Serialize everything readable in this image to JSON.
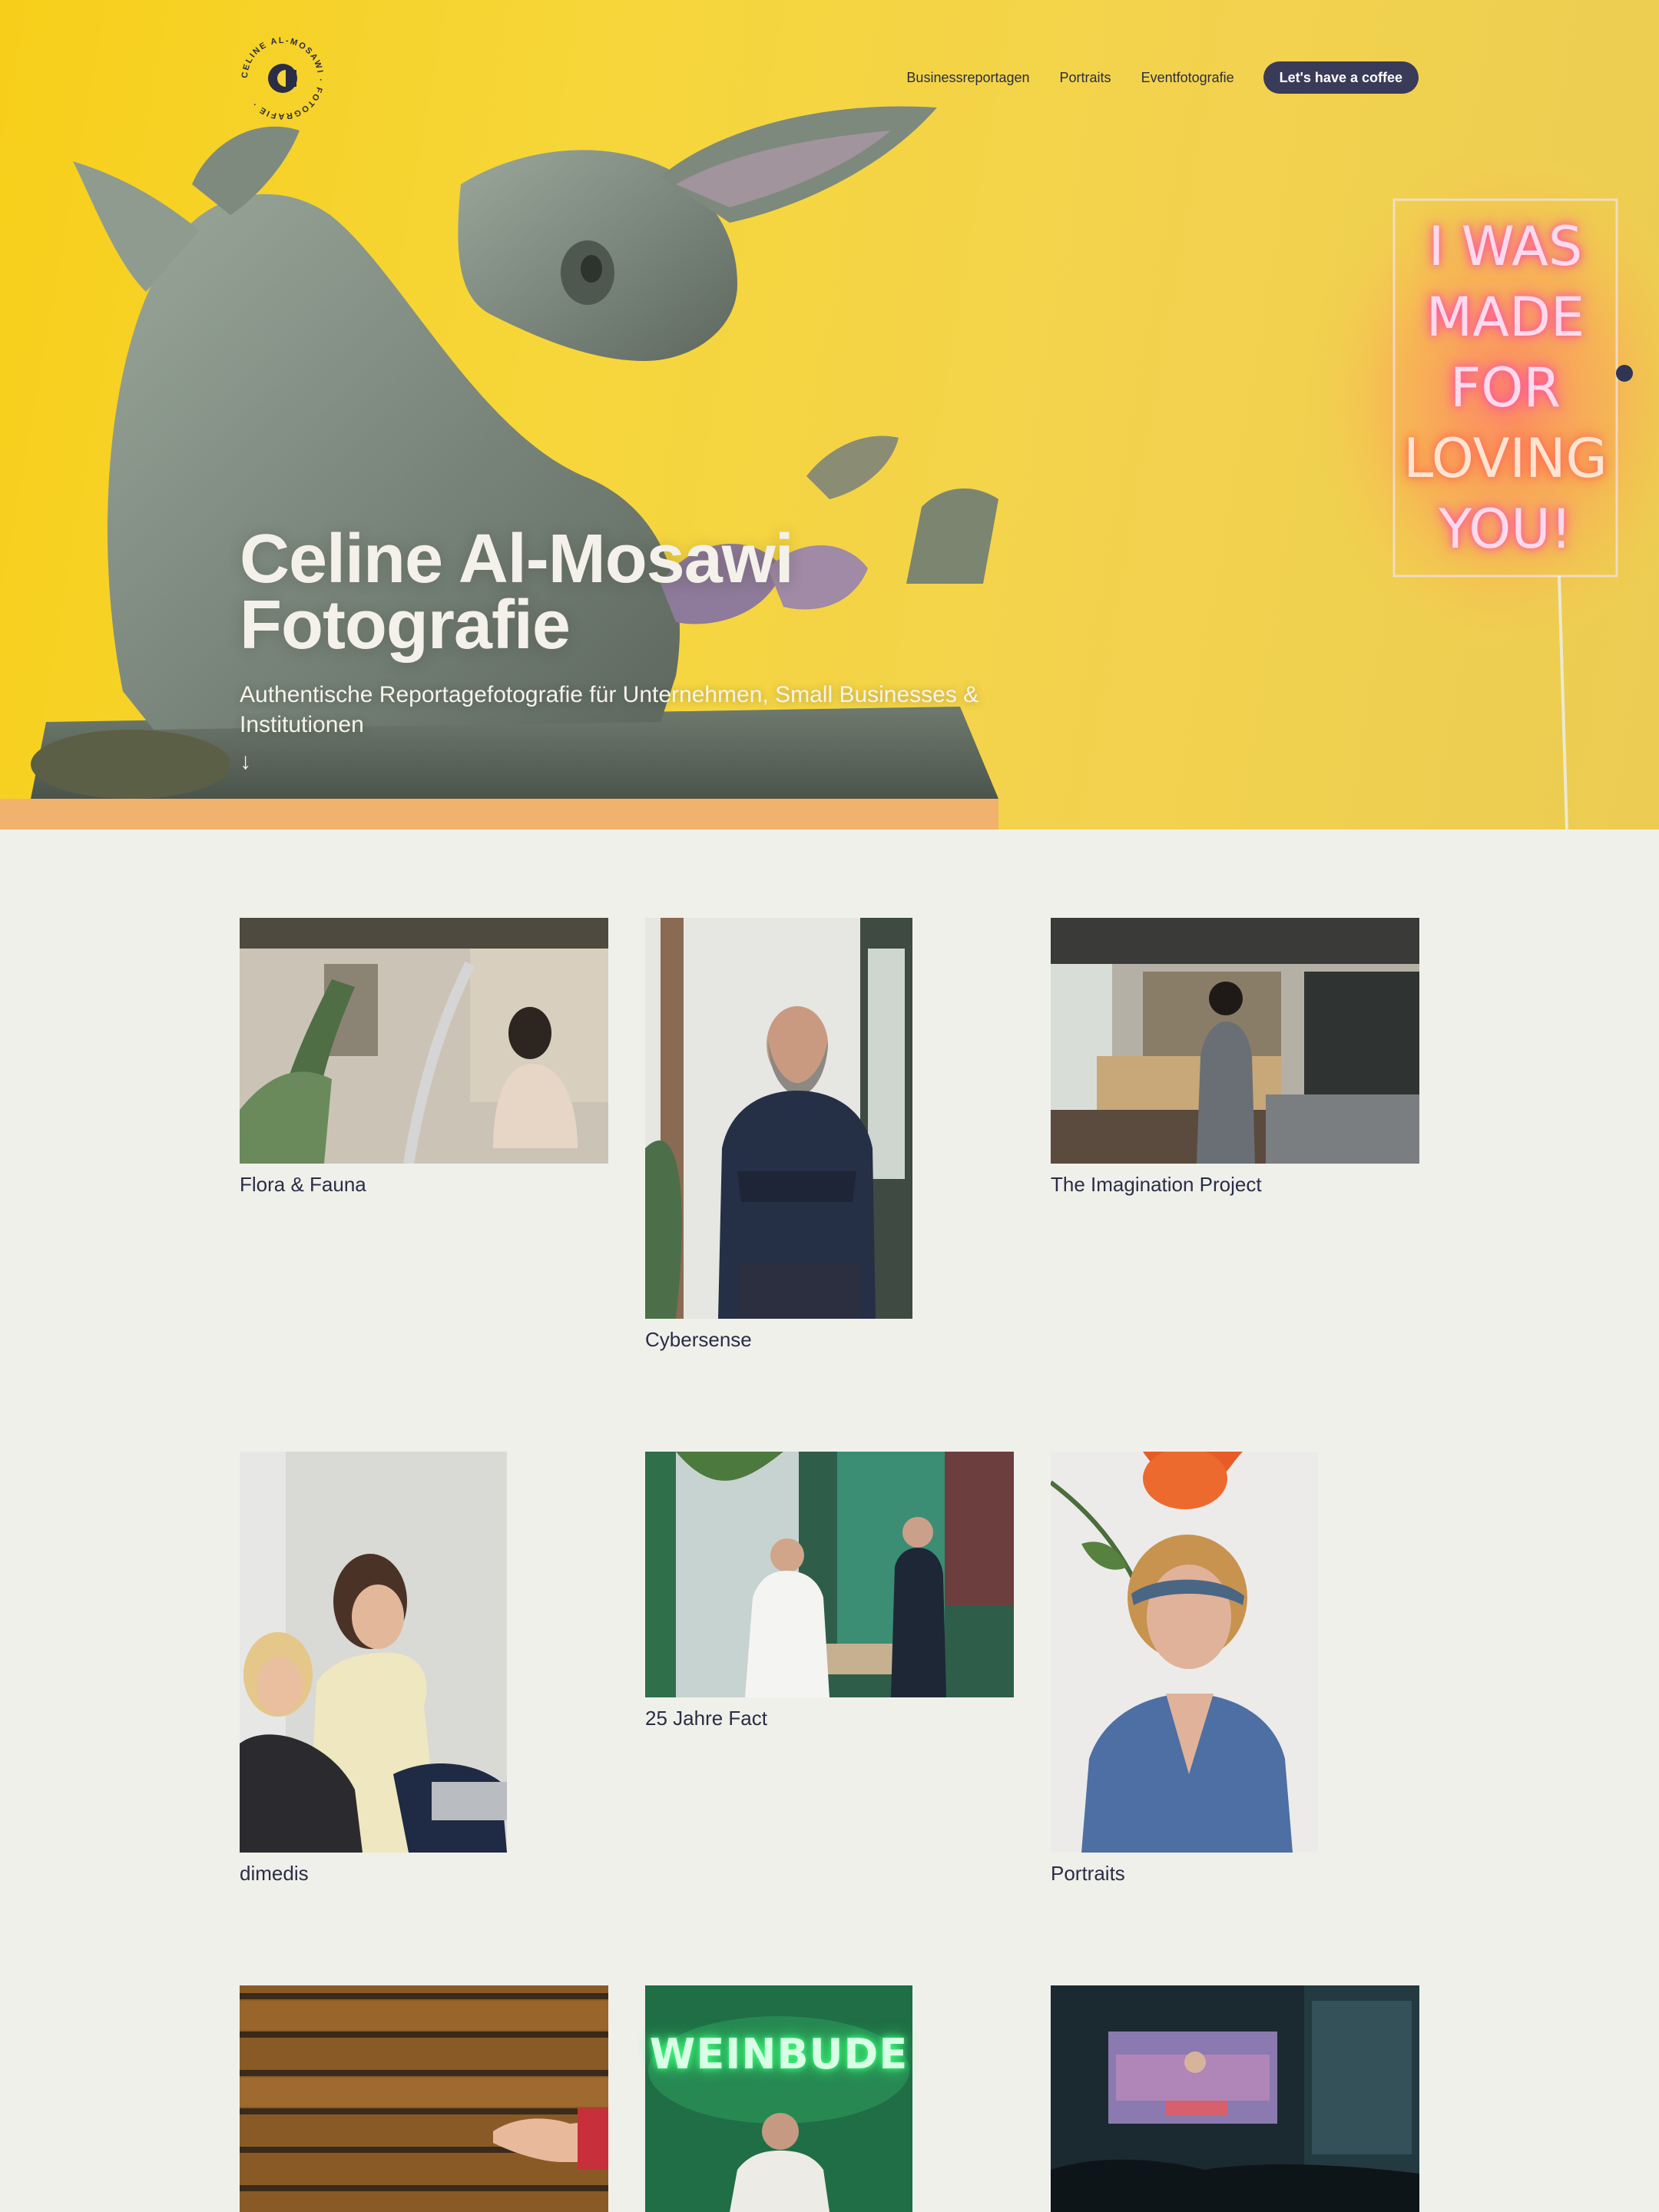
{
  "logo": {
    "ring_text": "CELINE AL-MOSAWI · FOTOGRAFIE ·",
    "monogram": "C"
  },
  "nav": {
    "links": [
      "Businessreportagen",
      "Portraits",
      "Eventfotografie"
    ],
    "cta": "Let's have a coffee"
  },
  "hero": {
    "title_line1": "Celine Al-Mosawi",
    "title_line2": "Fotografie",
    "subtitle": "Authentische Reportagefotografie für Unternehmen, Small Businesses & Institutionen",
    "arrow": "↓",
    "neon_lines": [
      "I WAS",
      "MADE",
      "FOR",
      "LOVING",
      "YOU!"
    ]
  },
  "projects": [
    {
      "title": "Flora & Fauna"
    },
    {
      "title": "Cybersense"
    },
    {
      "title": "The Imagination Project"
    },
    {
      "title": "dimedis"
    },
    {
      "title": "25 Jahre Fact"
    },
    {
      "title": "Portraits"
    },
    {
      "title": ""
    },
    {
      "title": "",
      "neon": "WEINBUDE"
    },
    {
      "title": ""
    }
  ],
  "colors": {
    "accent": "#3a3b58",
    "hero_yellow": "#f6d63a",
    "background": "#f0f0eb",
    "text": "#2a2d45",
    "neon_pink": "#ff5fa0"
  }
}
